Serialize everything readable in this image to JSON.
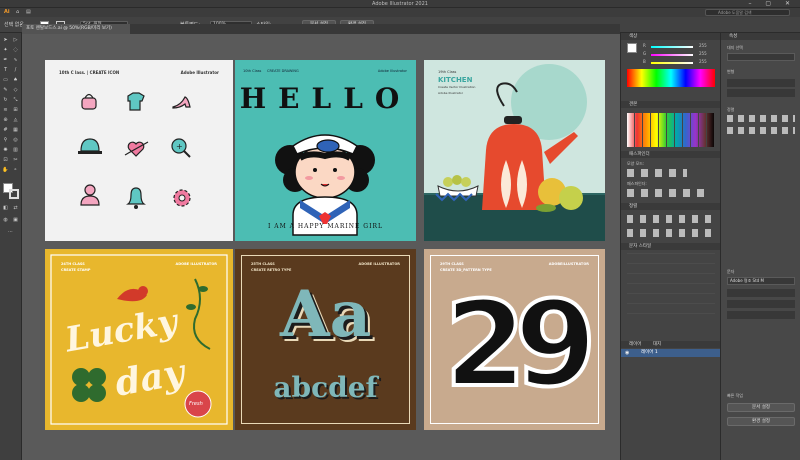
{
  "app": {
    "window_title": "Adobe Illustrator 2021",
    "search_placeholder": "Adobe 도움말 검색"
  },
  "menu": [],
  "control_bar": {
    "selection_label": "선택 없음",
    "stroke_value": "5pt. 원형",
    "opacity_label": "불투명도:",
    "opacity_value": "100%",
    "style_label": "스타일:",
    "doc_setup": "문서 설정",
    "prefs": "환경 설정"
  },
  "document": {
    "tab_title": "포토 렌탈보드스.ai @ 50%(RGB/미리 보기)"
  },
  "artboards": {
    "a1": {
      "left_header": "10th C lass. | CREATE ICON",
      "right_header": "Adobe Illustrator"
    },
    "a2": {
      "top_left": "10th Class",
      "top_sub": "CREATE DRAWING",
      "top_right": "Adobe Illustrator",
      "hello": "HELLO",
      "caption": "I AM A HAPPY MARINE GIRL"
    },
    "a3": {
      "class": "19th Class",
      "title": "KITCHEN",
      "sub": "Create Vector Illustration",
      "brand": "Adobe Illustrator"
    },
    "a4": {
      "top_left": "24TH CLASS",
      "top_sub": "CREATE STAMP",
      "top_right": "ADOBE ILLUSTRATOR",
      "word1": "Lucky",
      "word2": "day",
      "stamp": "Fresh"
    },
    "a5": {
      "top_left": "25TH CLASS",
      "top_sub": "CREATE RETRO TYPE",
      "top_right": "ADOBE ILLUSTRATOR",
      "big": "Aa",
      "lower": "abcdef"
    },
    "a6": {
      "top_left": "29TH CLASS",
      "top_sub": "CREATE 3D_PATTERN TYPE",
      "top_right": "ADOBEILLUSTRATOR",
      "number": "29"
    }
  },
  "right_panel": {
    "color": {
      "title": "색상",
      "r": "R",
      "g": "G",
      "b": "B",
      "r_val": "255",
      "g_val": "255",
      "b_val": "255"
    },
    "swatches_title": "견본",
    "pathfinder_title": "패스파인더",
    "align_title": "정렬",
    "shape_modes": "모양 모드:",
    "pathfinders": "패스파인더:",
    "char_title": "문자 스타일",
    "layers": {
      "title": "레이어",
      "artboards_tab": "대지",
      "layer1": "레이어 1"
    }
  },
  "right_panel2": {
    "props_title": "속성",
    "transform": "변형",
    "align": "정렬",
    "char_title": "문자",
    "font": "Adobe 명조 Std M",
    "artboard_label": "대지 선택",
    "quick_actions": "빠른 작업",
    "doc_setup_btn": "문서 설정",
    "prefs_btn": "환경 설정"
  },
  "colors": {
    "teal": "#4cbdb3",
    "yellow": "#e8b72d",
    "brown": "#5a3a1e",
    "tan": "#c8aa8e",
    "mint": "#cfe6df"
  }
}
